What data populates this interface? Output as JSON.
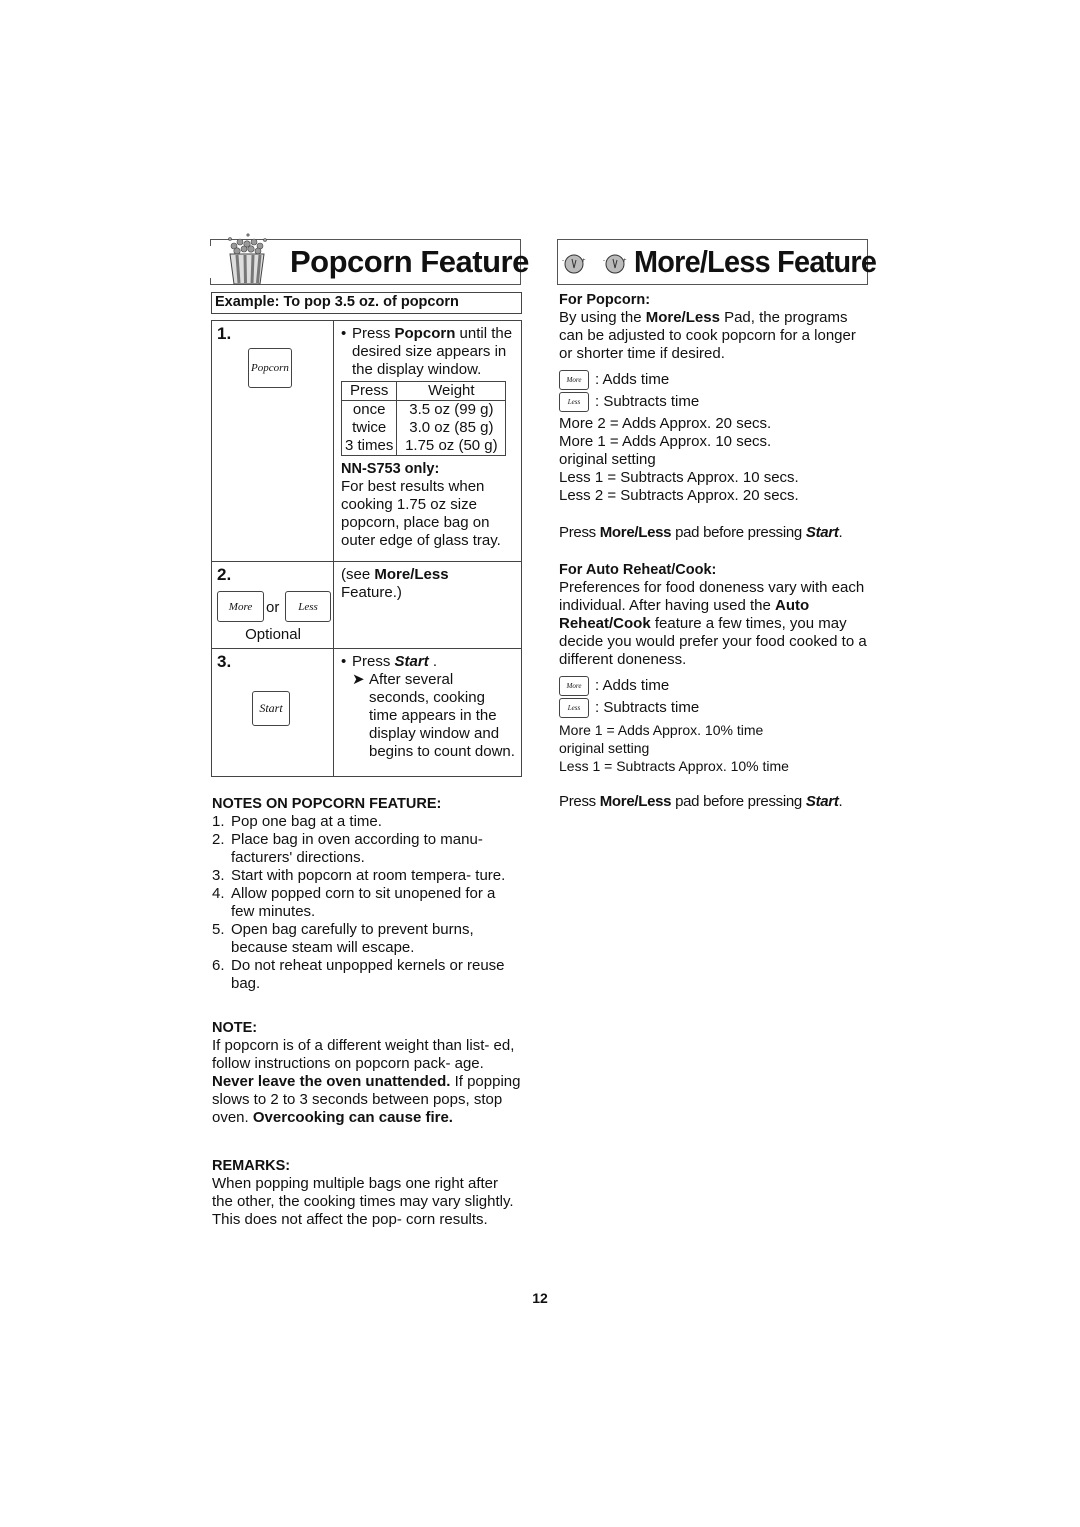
{
  "popcorn": {
    "title": "Popcorn Feature",
    "example": "Example: To pop 3.5 oz. of popcorn",
    "step1": {
      "num": "1.",
      "pad": "Popcorn",
      "bullet_pre": "Press ",
      "bullet_bold": "Popcorn",
      "bullet_post": " until the desired size appears in the display window.",
      "table": {
        "headers": [
          "Press",
          "Weight"
        ],
        "rows": [
          [
            "once",
            "3.5 oz (99 g)"
          ],
          [
            "twice",
            "3.0 oz (85 g)"
          ],
          [
            "3 times",
            "1.75 oz (50 g)"
          ]
        ]
      },
      "model_note_title": "NN-S753 only:",
      "model_note_text": "For best results when cooking 1.75 oz size popcorn, place bag on outer edge of glass tray."
    },
    "step2": {
      "num": "2.",
      "pad_more": "More",
      "or": "or",
      "pad_less": "Less",
      "optional": "Optional",
      "text_pre": "(see ",
      "text_bold": "More/Less",
      "text_post": " Feature.)"
    },
    "step3": {
      "num": "3.",
      "pad": "Start",
      "bullet_pre": "Press ",
      "bullet_bold": "Start",
      "bullet_post": " .",
      "arrow": "➤",
      "sub": "After several seconds, cooking time appears in the display window and begins to count down."
    },
    "notes": {
      "title": "NOTES ON POPCORN FEATURE:",
      "items": [
        {
          "n": "1.",
          "text": "Pop one bag at a time."
        },
        {
          "n": "2.",
          "text": "Place bag in oven according to manu- facturers' directions."
        },
        {
          "n": "3.",
          "text": "Start with popcorn at room tempera- ture."
        },
        {
          "n": "4.",
          "text": "Allow popped corn to sit unopened for a few minutes."
        },
        {
          "n": "5.",
          "text": "Open bag carefully to prevent burns, because steam will escape."
        },
        {
          "n": "6.",
          "text": "Do not reheat unpopped kernels or reuse bag."
        }
      ]
    },
    "note": {
      "title": "NOTE:",
      "t1": "If popcorn is of a different weight than list- ed, follow instructions on popcorn pack- age. ",
      "b1": "Never leave the oven unattended.",
      "t2": " If popping slows to 2 to 3 seconds between pops, stop oven. ",
      "b2": "Overcooking can cause fire."
    },
    "remarks": {
      "title": "REMARKS:",
      "text": "When popping multiple bags one right after the other, the cooking times may vary slightly. This does not affect the pop- corn results."
    }
  },
  "moreless": {
    "title": "More/Less Feature",
    "popcorn": {
      "title": "For Popcorn:",
      "p_pre": "By using the ",
      "p_bold": "More/Less",
      "p_post": " Pad, the programs can be adjusted to cook popcorn for a longer or shorter time if desired.",
      "legend": [
        {
          "pad": "More",
          "text": ": Adds time"
        },
        {
          "pad": "Less",
          "text": ": Subtracts time"
        }
      ],
      "levels": [
        "More 2 = Adds Approx. 20 secs.",
        "More 1 = Adds Approx. 10 secs.",
        "original setting",
        "Less 1 = Subtracts Approx. 10 secs.",
        "Less 2 = Subtracts Approx. 20 secs."
      ],
      "press_pre": "Press ",
      "press_bold": "More/Less",
      "press_mid": " pad before pressing ",
      "press_it": "Start",
      "press_end": "."
    },
    "auto": {
      "title": "For Auto Reheat/Cook:",
      "p1": "Preferences for food doneness vary with each individual. After having used the ",
      "b1": "Auto Reheat/Cook",
      "p2": " feature a few times, you may decide you would prefer your food cooked to a different doneness.",
      "legend": [
        {
          "pad": "More",
          "text": ": Adds time"
        },
        {
          "pad": "Less",
          "text": ": Subtracts time"
        }
      ],
      "levels": [
        "More 1 = Adds Approx. 10% time",
        "original setting",
        "Less 1 = Subtracts Approx. 10% time"
      ],
      "press_pre": "Press ",
      "press_bold": "More/Less",
      "press_mid": " pad before pressing ",
      "press_it": "Start",
      "press_end": "."
    }
  },
  "page_number": "12"
}
